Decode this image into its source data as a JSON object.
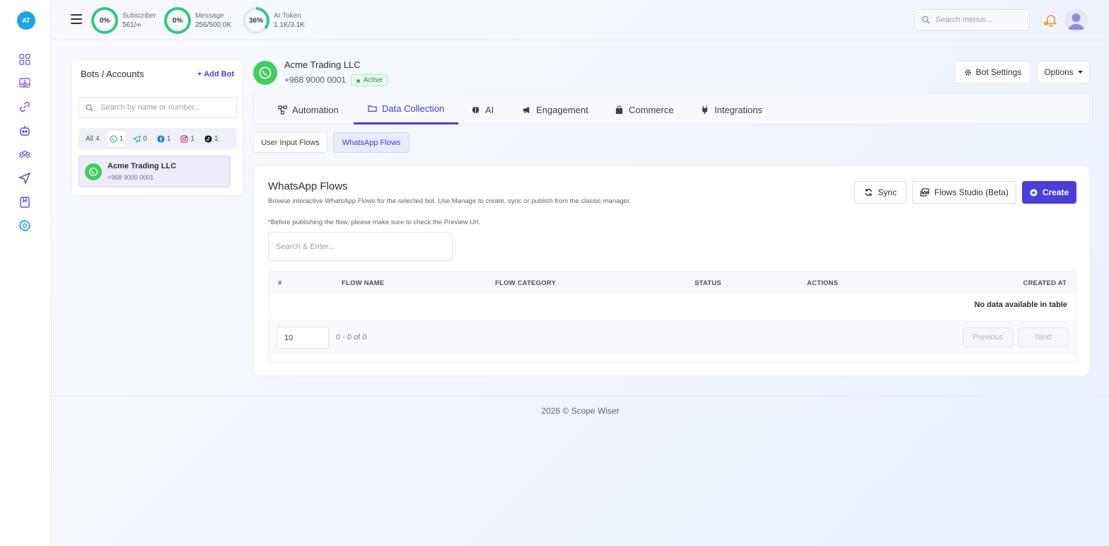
{
  "rail": {
    "logo_initials": "AT",
    "icons": [
      "dashboard-icon",
      "inbox-download-icon",
      "link-icon",
      "bot-icon",
      "users-group-icon",
      "send-icon",
      "bookmark-icon",
      "settings-icon"
    ]
  },
  "topbar": {
    "stats": [
      {
        "percent": "0%",
        "label": "Subscriber",
        "value": "561/∞",
        "fraction": 0.0
      },
      {
        "percent": "0%",
        "label": "Message",
        "value": "256/500.0K",
        "fraction": 0.0
      },
      {
        "percent": "36%",
        "label": "AI Token",
        "value": "1.1K/3.1K",
        "fraction": 0.36
      }
    ],
    "search_placeholder": "Search menus...",
    "ring_color": "#34c77b"
  },
  "bots_panel": {
    "title": "Bots / Accounts",
    "add_label": "+ Add Bot",
    "search_placeholder": "Search by name or number...",
    "channels": [
      {
        "label": "All",
        "count": "4"
      },
      {
        "icon": "whatsapp-icon",
        "count": "1"
      },
      {
        "icon": "telegram-icon",
        "count": "0"
      },
      {
        "icon": "facebook-icon",
        "count": "1"
      },
      {
        "icon": "instagram-icon",
        "count": "1"
      },
      {
        "icon": "tiktok-icon",
        "count": "1"
      }
    ],
    "items": [
      {
        "name": "Acme Trading LLC",
        "phone": "+968 9000 0001"
      }
    ]
  },
  "header": {
    "bot_name": "Acme Trading LLC",
    "bot_phone": "+968 9000 0001",
    "status": "Active",
    "bot_settings_label": "Bot Settings",
    "options_label": "Options"
  },
  "tabs": [
    {
      "label": "Automation",
      "icon": "flow-icon"
    },
    {
      "label": "Data Collection",
      "icon": "folder-icon",
      "active": true
    },
    {
      "label": "AI",
      "icon": "brain-icon"
    },
    {
      "label": "Engagement",
      "icon": "megaphone-icon"
    },
    {
      "label": "Commerce",
      "icon": "bag-icon"
    },
    {
      "label": "Integrations",
      "icon": "plug-icon"
    }
  ],
  "subtabs": [
    {
      "label": "User Input Flows"
    },
    {
      "label": "WhatsApp Flows",
      "active": true
    }
  ],
  "card": {
    "title": "WhatsApp Flows",
    "description": "Browse interactive WhatsApp Flows for the selected bot. Use Manage to create, sync or publish from the classic manager.",
    "note": "*Before publishing the flow, please make sure to check the Preview Url.",
    "search_placeholder": "Search & Enter...",
    "sync_label": "Sync",
    "studio_label": "Flows Studio (Beta)",
    "create_label": "Create",
    "accent": "#4a3fd6"
  },
  "table": {
    "columns": [
      "#",
      "FLOW NAME",
      "FLOW CATEGORY",
      "STATUS",
      "ACTIONS",
      "CREATED AT"
    ],
    "empty_text": "No data available in table",
    "page_size": "10",
    "range": "0 - 0 of 0",
    "prev_label": "Previous",
    "next_label": "Next"
  },
  "footer": {
    "text": "2026 © Scope Wiser"
  }
}
